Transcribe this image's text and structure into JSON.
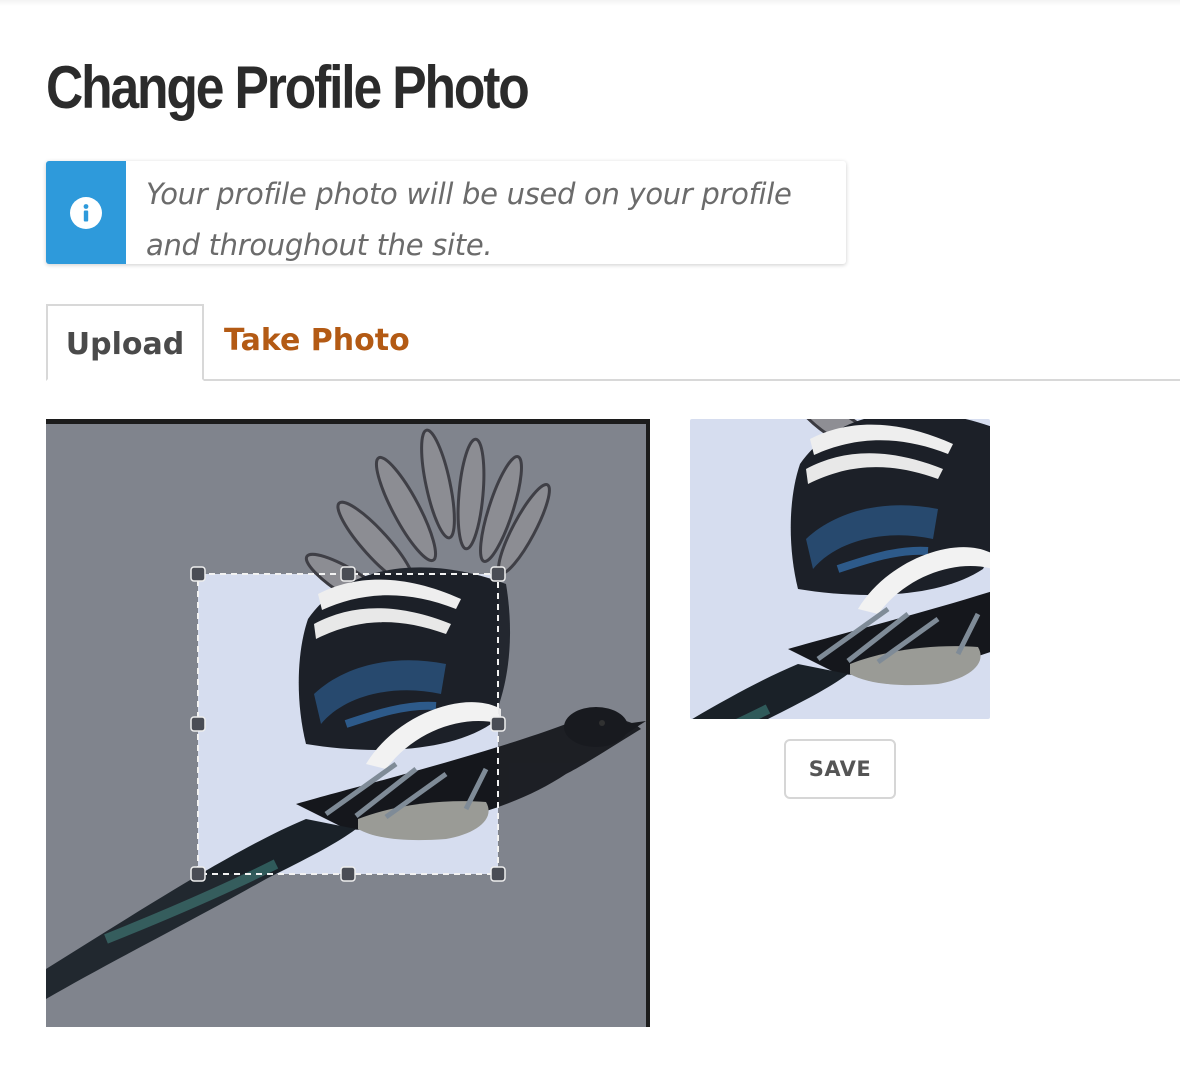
{
  "page": {
    "title": "Change Profile Photo"
  },
  "info": {
    "icon": "info-icon",
    "line1": "Your profile photo will be used on your profile",
    "line2": "and throughout the site.",
    "accent_color": "#2e9adb"
  },
  "tabs": [
    {
      "label": "Upload",
      "active": true
    },
    {
      "label": "Take Photo",
      "active": false,
      "color": "#b35a14"
    }
  ],
  "cropper": {
    "image_subject": "magpie in flight",
    "background_color": "#80848d",
    "crop_fill_color": "#d6ddef"
  },
  "preview": {
    "background_color": "#d6ddef"
  },
  "actions": {
    "save_label": "SAVE"
  }
}
